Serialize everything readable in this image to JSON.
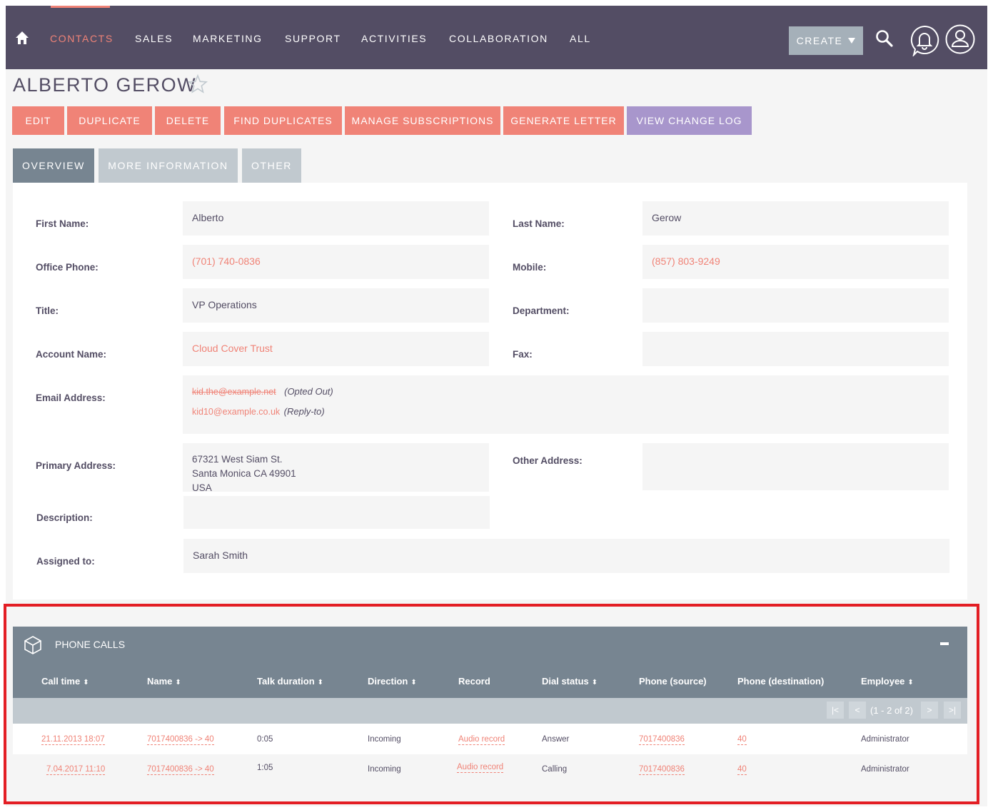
{
  "nav": {
    "items": [
      "CONTACTS",
      "SALES",
      "MARKETING",
      "SUPPORT",
      "ACTIVITIES",
      "COLLABORATION",
      "ALL"
    ],
    "active": "CONTACTS",
    "create_label": "CREATE",
    "colors": {
      "bar": "#534d64",
      "accent": "#f08377"
    }
  },
  "header": {
    "title": "ALBERTO GEROW",
    "actions": [
      "EDIT",
      "DUPLICATE",
      "DELETE",
      "FIND DUPLICATES",
      "MANAGE SUBSCRIPTIONS",
      "GENERATE LETTER",
      "VIEW CHANGE LOG"
    ]
  },
  "tabs": [
    "OVERVIEW",
    "MORE INFORMATION",
    "OTHER"
  ],
  "fields": {
    "first_name": {
      "label": "First Name:",
      "value": "Alberto"
    },
    "last_name": {
      "label": "Last Name:",
      "value": "Gerow"
    },
    "office_phone": {
      "label": "Office Phone:",
      "value": "(701) 740-0836"
    },
    "mobile": {
      "label": "Mobile:",
      "value": "(857) 803-9249"
    },
    "title": {
      "label": "Title:",
      "value": "VP Operations"
    },
    "department": {
      "label": "Department:",
      "value": ""
    },
    "account_name": {
      "label": "Account Name:",
      "value": "Cloud Cover Trust"
    },
    "fax": {
      "label": "Fax:",
      "value": ""
    },
    "email": {
      "label": "Email Address:",
      "primary": "kid.the@example.net",
      "primary_note": "(Opted Out)",
      "secondary": "kid10@example.co.uk",
      "secondary_note": "(Reply-to)"
    },
    "primary_address": {
      "label": "Primary Address:",
      "line1": "67321 West Siam St.",
      "line2": "Santa Monica CA  49901",
      "line3": "USA"
    },
    "other_address": {
      "label": "Other Address:",
      "value": ""
    },
    "description": {
      "label": "Description:",
      "value": ""
    },
    "assigned_to": {
      "label": "Assigned to:",
      "value": "Sarah Smith"
    }
  },
  "phone_calls": {
    "title": "PHONE CALLS",
    "columns": [
      "Call time",
      "Name",
      "Talk duration",
      "Direction",
      "Record",
      "Dial status",
      "Phone (source)",
      "Phone (destination)",
      "Employee"
    ],
    "pagination": "(1 - 2 of 2)",
    "rows": [
      {
        "call_time": "21.11.2013 18:07",
        "name": "7017400836 -> 40",
        "talk_duration": "0:05",
        "direction": "Incoming",
        "record": "Audio record",
        "dial_status": "Answer",
        "phone_source": "7017400836",
        "phone_destination": "40",
        "employee": "Administrator"
      },
      {
        "call_time": "7.04.2017 11:10",
        "name": "7017400836 -> 40",
        "talk_duration": "1:05",
        "direction": "Incoming",
        "record": "Audio record",
        "dial_status": "Calling",
        "phone_source": "7017400836",
        "phone_destination": "40",
        "employee": "Administrator"
      }
    ]
  }
}
